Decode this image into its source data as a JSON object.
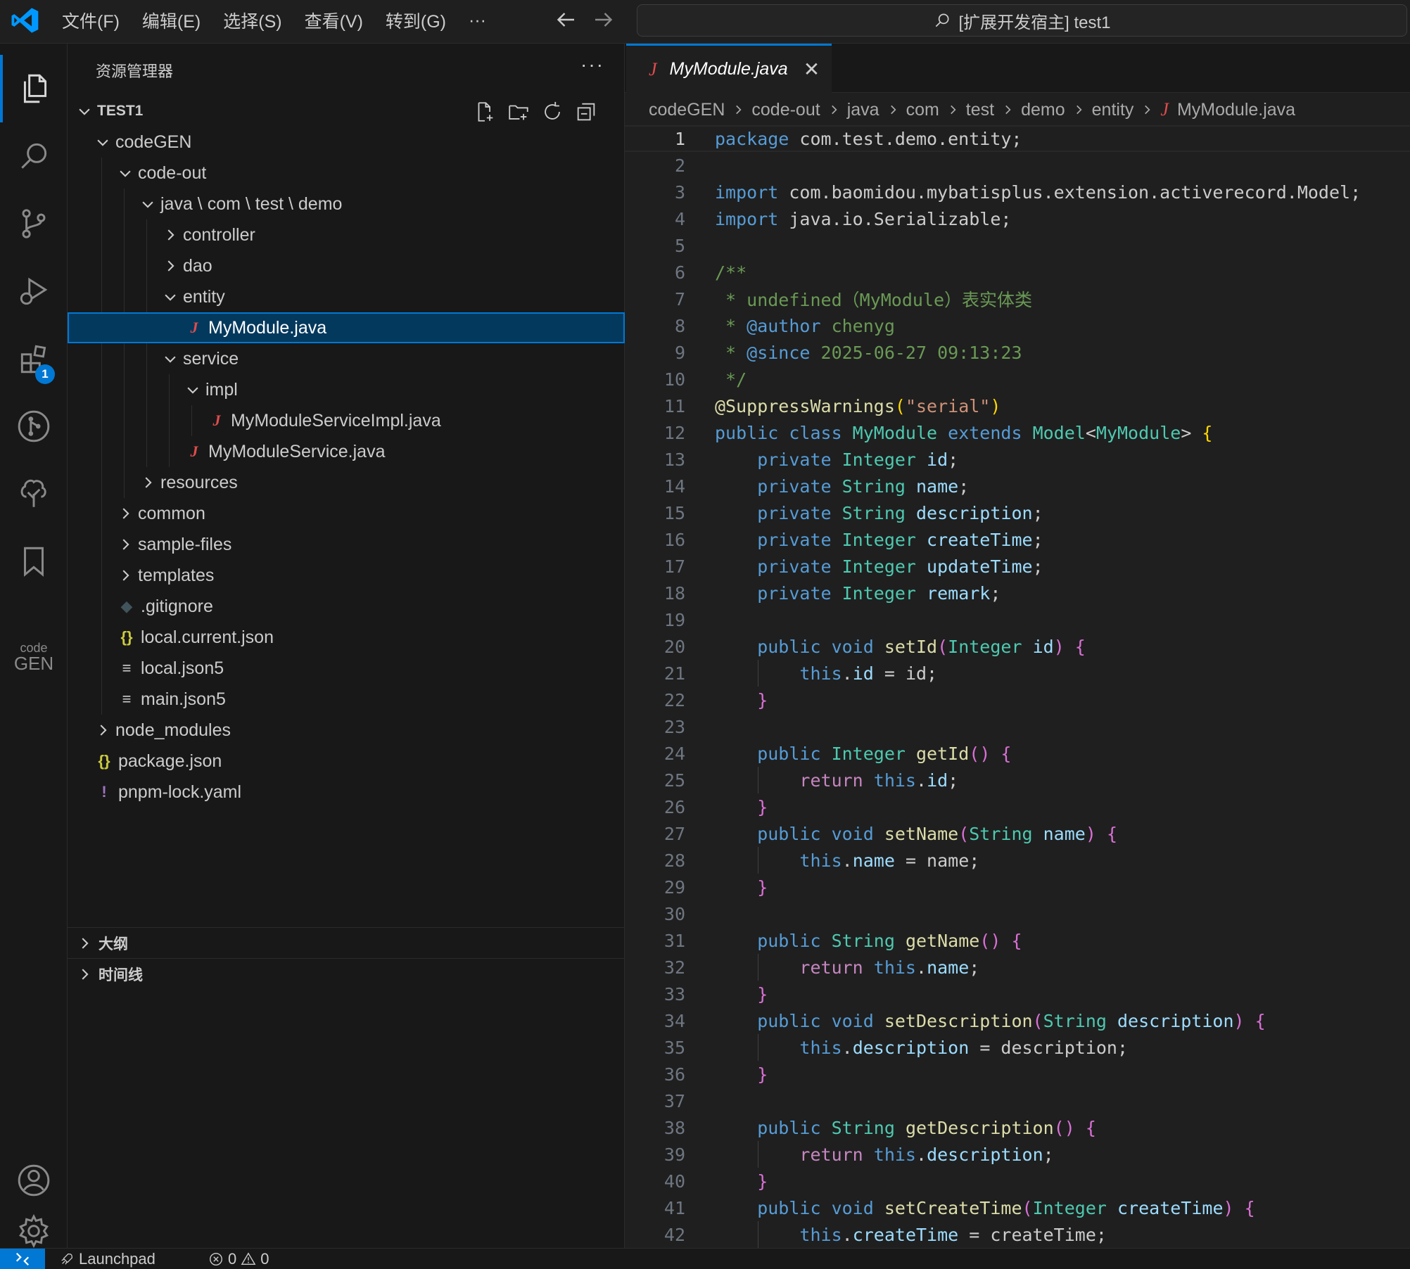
{
  "titlebar": {
    "menu": [
      "文件(F)",
      "编辑(E)",
      "选择(S)",
      "查看(V)",
      "转到(G)",
      "···"
    ],
    "search_label": "[扩展开发宿主] test1"
  },
  "activity": {
    "extensions_badge": "1",
    "codegen_small": "code",
    "codegen_big": "GEN"
  },
  "sidebar": {
    "title": "资源管理器",
    "more": "···",
    "root": "TEST1",
    "tree": [
      {
        "label": "codeGEN",
        "depth": 0,
        "type": "folder-open"
      },
      {
        "label": "code-out",
        "depth": 1,
        "type": "folder-open"
      },
      {
        "label": "java \\ com \\ test \\ demo",
        "depth": 2,
        "type": "folder-open"
      },
      {
        "label": "controller",
        "depth": 3,
        "type": "folder"
      },
      {
        "label": "dao",
        "depth": 3,
        "type": "folder"
      },
      {
        "label": "entity",
        "depth": 3,
        "type": "folder-open"
      },
      {
        "label": "MyModule.java",
        "depth": 4,
        "type": "java",
        "selected": true
      },
      {
        "label": "service",
        "depth": 3,
        "type": "folder-open"
      },
      {
        "label": "impl",
        "depth": 4,
        "type": "folder-open"
      },
      {
        "label": "MyModuleServiceImpl.java",
        "depth": 5,
        "type": "java"
      },
      {
        "label": "MyModuleService.java",
        "depth": 4,
        "type": "java"
      },
      {
        "label": "resources",
        "depth": 2,
        "type": "folder"
      },
      {
        "label": "common",
        "depth": 1,
        "type": "folder"
      },
      {
        "label": "sample-files",
        "depth": 1,
        "type": "folder"
      },
      {
        "label": "templates",
        "depth": 1,
        "type": "folder"
      },
      {
        "label": ".gitignore",
        "depth": 1,
        "type": "git"
      },
      {
        "label": "local.current.json",
        "depth": 1,
        "type": "json"
      },
      {
        "label": "local.json5",
        "depth": 1,
        "type": "text"
      },
      {
        "label": "main.json5",
        "depth": 1,
        "type": "text"
      },
      {
        "label": "node_modules",
        "depth": 0,
        "type": "folder"
      },
      {
        "label": "package.json",
        "depth": 0,
        "type": "json"
      },
      {
        "label": "pnpm-lock.yaml",
        "depth": 0,
        "type": "yaml"
      }
    ],
    "outline_label": "大纲",
    "timeline_label": "时间线"
  },
  "editor": {
    "tab_label": "MyModule.java",
    "breadcrumb": [
      "codeGEN",
      "code-out",
      "java",
      "com",
      "test",
      "demo",
      "entity",
      "MyModule.java"
    ],
    "current_line": 1,
    "lines": [
      [
        [
          "package",
          "kw"
        ],
        [
          " com.test.demo.entity;",
          "pl"
        ]
      ],
      [],
      [
        [
          "import",
          "kw"
        ],
        [
          " com.baomidou.mybatisplus.extension.activerecord.Model;",
          "pl"
        ]
      ],
      [
        [
          "import",
          "kw"
        ],
        [
          " java.io.Serializable;",
          "pl"
        ]
      ],
      [],
      [
        [
          "/**",
          "cm"
        ]
      ],
      [
        [
          " * undefined（MyModule）表实体类",
          "cm"
        ]
      ],
      [
        [
          " * ",
          "cm"
        ],
        [
          "@author",
          "cmtag"
        ],
        [
          " chenyg",
          "cm"
        ]
      ],
      [
        [
          " * ",
          "cm"
        ],
        [
          "@since",
          "cmtag"
        ],
        [
          " 2025-06-27 09:13:23",
          "cm"
        ]
      ],
      [
        [
          " */",
          "cm"
        ]
      ],
      [
        [
          "@SuppressWarnings",
          "fn"
        ],
        [
          "(",
          "br1"
        ],
        [
          "\"serial\"",
          "str"
        ],
        [
          ")",
          "br1"
        ]
      ],
      [
        [
          "public class ",
          "kw"
        ],
        [
          "MyModule ",
          "ty"
        ],
        [
          "extends ",
          "kw"
        ],
        [
          "Model",
          "ty"
        ],
        [
          "<",
          "pl"
        ],
        [
          "MyModule",
          "ty"
        ],
        [
          "> ",
          "pl"
        ],
        [
          "{",
          "br1"
        ]
      ],
      [
        [
          "    private ",
          "kw"
        ],
        [
          "Integer ",
          "ty"
        ],
        [
          "id",
          "var"
        ],
        [
          ";",
          "pl"
        ]
      ],
      [
        [
          "    private ",
          "kw"
        ],
        [
          "String ",
          "ty"
        ],
        [
          "name",
          "var"
        ],
        [
          ";",
          "pl"
        ]
      ],
      [
        [
          "    private ",
          "kw"
        ],
        [
          "String ",
          "ty"
        ],
        [
          "description",
          "var"
        ],
        [
          ";",
          "pl"
        ]
      ],
      [
        [
          "    private ",
          "kw"
        ],
        [
          "Integer ",
          "ty"
        ],
        [
          "createTime",
          "var"
        ],
        [
          ";",
          "pl"
        ]
      ],
      [
        [
          "    private ",
          "kw"
        ],
        [
          "Integer ",
          "ty"
        ],
        [
          "updateTime",
          "var"
        ],
        [
          ";",
          "pl"
        ]
      ],
      [
        [
          "    private ",
          "kw"
        ],
        [
          "Integer ",
          "ty"
        ],
        [
          "remark",
          "var"
        ],
        [
          ";",
          "pl"
        ]
      ],
      [],
      [
        [
          "    public void ",
          "kw"
        ],
        [
          "setId",
          "fn"
        ],
        [
          "(",
          "br2"
        ],
        [
          "Integer ",
          "ty"
        ],
        [
          "id",
          "var"
        ],
        [
          ") ",
          "br2"
        ],
        [
          "{",
          "br2"
        ]
      ],
      [
        [
          "        this",
          "kw"
        ],
        [
          ".",
          "pl"
        ],
        [
          "id",
          "var"
        ],
        [
          " = id;",
          "pl"
        ]
      ],
      [
        [
          "    }",
          "br2"
        ]
      ],
      [],
      [
        [
          "    public ",
          "kw"
        ],
        [
          "Integer ",
          "ty"
        ],
        [
          "getId",
          "fn"
        ],
        [
          "() ",
          "br2"
        ],
        [
          "{",
          "br2"
        ]
      ],
      [
        [
          "        return ",
          "ctl"
        ],
        [
          "this",
          "kw"
        ],
        [
          ".",
          "pl"
        ],
        [
          "id",
          "var"
        ],
        [
          ";",
          "pl"
        ]
      ],
      [
        [
          "    }",
          "br2"
        ]
      ],
      [
        [
          "    public void ",
          "kw"
        ],
        [
          "setName",
          "fn"
        ],
        [
          "(",
          "br2"
        ],
        [
          "String ",
          "ty"
        ],
        [
          "name",
          "var"
        ],
        [
          ") ",
          "br2"
        ],
        [
          "{",
          "br2"
        ]
      ],
      [
        [
          "        this",
          "kw"
        ],
        [
          ".",
          "pl"
        ],
        [
          "name",
          "var"
        ],
        [
          " = name;",
          "pl"
        ]
      ],
      [
        [
          "    }",
          "br2"
        ]
      ],
      [],
      [
        [
          "    public ",
          "kw"
        ],
        [
          "String ",
          "ty"
        ],
        [
          "getName",
          "fn"
        ],
        [
          "() ",
          "br2"
        ],
        [
          "{",
          "br2"
        ]
      ],
      [
        [
          "        return ",
          "ctl"
        ],
        [
          "this",
          "kw"
        ],
        [
          ".",
          "pl"
        ],
        [
          "name",
          "var"
        ],
        [
          ";",
          "pl"
        ]
      ],
      [
        [
          "    }",
          "br2"
        ]
      ],
      [
        [
          "    public void ",
          "kw"
        ],
        [
          "setDescription",
          "fn"
        ],
        [
          "(",
          "br2"
        ],
        [
          "String ",
          "ty"
        ],
        [
          "description",
          "var"
        ],
        [
          ") ",
          "br2"
        ],
        [
          "{",
          "br2"
        ]
      ],
      [
        [
          "        this",
          "kw"
        ],
        [
          ".",
          "pl"
        ],
        [
          "description",
          "var"
        ],
        [
          " = description;",
          "pl"
        ]
      ],
      [
        [
          "    }",
          "br2"
        ]
      ],
      [],
      [
        [
          "    public ",
          "kw"
        ],
        [
          "String ",
          "ty"
        ],
        [
          "getDescription",
          "fn"
        ],
        [
          "() ",
          "br2"
        ],
        [
          "{",
          "br2"
        ]
      ],
      [
        [
          "        return ",
          "ctl"
        ],
        [
          "this",
          "kw"
        ],
        [
          ".",
          "pl"
        ],
        [
          "description",
          "var"
        ],
        [
          ";",
          "pl"
        ]
      ],
      [
        [
          "    }",
          "br2"
        ]
      ],
      [
        [
          "    public void ",
          "kw"
        ],
        [
          "setCreateTime",
          "fn"
        ],
        [
          "(",
          "br2"
        ],
        [
          "Integer ",
          "ty"
        ],
        [
          "createTime",
          "var"
        ],
        [
          ") ",
          "br2"
        ],
        [
          "{",
          "br2"
        ]
      ],
      [
        [
          "        this",
          "kw"
        ],
        [
          ".",
          "pl"
        ],
        [
          "createTime",
          "var"
        ],
        [
          " = createTime;",
          "pl"
        ]
      ]
    ]
  },
  "statusbar": {
    "launchpad": "Launchpad",
    "errors": "0",
    "warnings": "0"
  },
  "colors": {
    "kw": "#569cd6",
    "ctl": "#c586c0",
    "ty": "#4ec9b0",
    "fn": "#dcdcaa",
    "var": "#9cdcfe",
    "str": "#ce9178",
    "cm": "#6a9955",
    "cmtag": "#569cd6",
    "br1": "#ffd700",
    "br2": "#da70d6",
    "pl": "#cccccc",
    "accent": "#0078d4"
  }
}
